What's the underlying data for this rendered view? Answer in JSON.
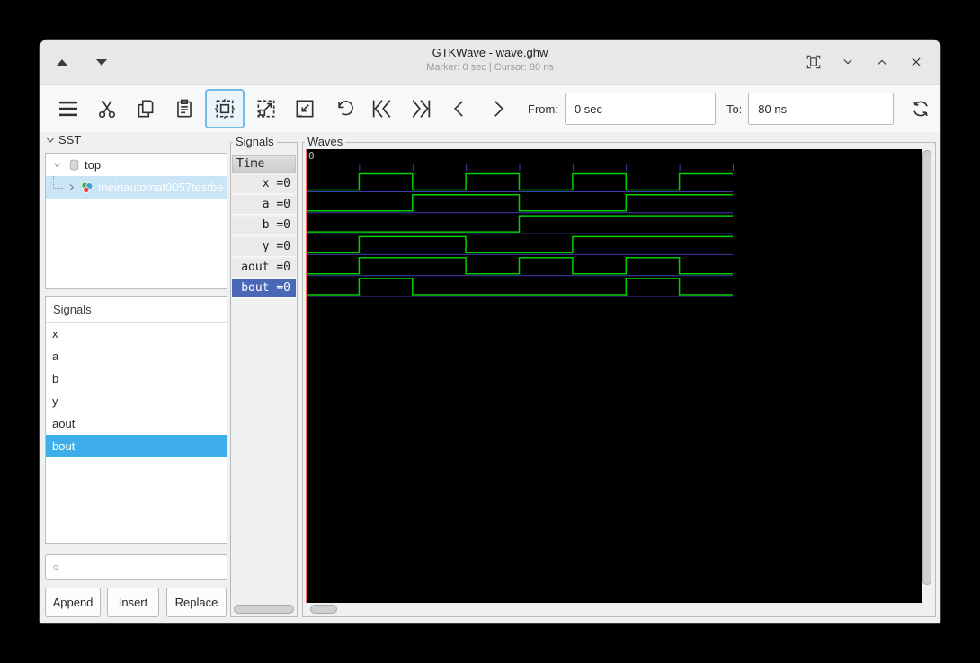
{
  "window": {
    "title": "GTKWave - wave.ghw",
    "subtitle": "Marker: 0 sec  |  Cursor: 80 ns"
  },
  "toolbar": {
    "from_label": "From:",
    "from_value": "0 sec",
    "to_label": "To:",
    "to_value": "80 ns"
  },
  "sst": {
    "header": "SST",
    "root_item": "top",
    "child_item": "meinautomat0057testbe"
  },
  "left_signals": {
    "header": "Signals",
    "items": [
      "x",
      "a",
      "b",
      "y",
      "aout",
      "bout"
    ],
    "selected": "bout",
    "buttons": [
      "Append",
      "Insert",
      "Replace"
    ]
  },
  "signals_column": {
    "frame_label": "Signals",
    "time_header": "Time",
    "rows": [
      "x =0",
      "a =0",
      "b =0",
      "y =0",
      "aout =0",
      "bout =0"
    ],
    "selected_row": "bout =0"
  },
  "waves": {
    "frame_label": "Waves",
    "origin_label": "0"
  },
  "chart_data": {
    "type": "digital-waveform",
    "title": "GTKWave trace of wave.ghw",
    "time_unit": "ns",
    "t_start": 0,
    "t_end": 80,
    "tick_interval": 10,
    "cursor_time": 0,
    "signals": [
      {
        "name": "x",
        "initial": 0,
        "transitions": [
          10,
          20,
          30,
          40,
          50,
          60,
          70
        ]
      },
      {
        "name": "a",
        "initial": 0,
        "transitions": [
          20,
          40,
          60
        ]
      },
      {
        "name": "b",
        "initial": 0,
        "transitions": [
          40
        ]
      },
      {
        "name": "y",
        "initial": 0,
        "transitions": [
          10,
          30,
          50
        ]
      },
      {
        "name": "aout",
        "initial": 0,
        "transitions": [
          10,
          30,
          40,
          50,
          60,
          70
        ]
      },
      {
        "name": "bout",
        "initial": 0,
        "transitions": [
          10,
          20,
          60,
          70
        ]
      }
    ],
    "colors": {
      "trace": "#00cf00",
      "baseline": "#3c3cac",
      "ruler": "#3c3cac",
      "marker": "#ff6b6b",
      "background": "#000000"
    }
  }
}
